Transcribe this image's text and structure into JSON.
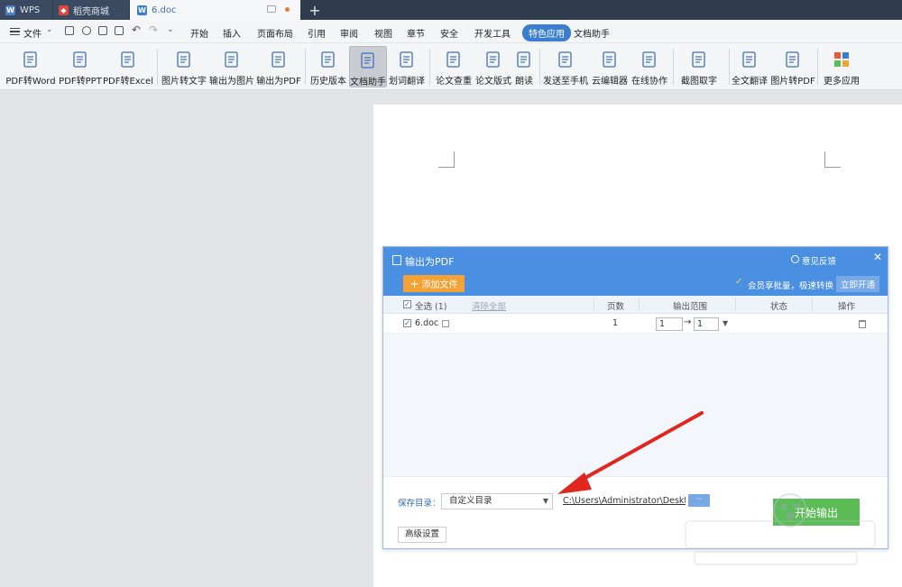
{
  "tabs": {
    "wps": "WPS",
    "shop": "稻壳商城",
    "doc": "6.doc"
  },
  "menu": {
    "file": "文件",
    "items": [
      "开始",
      "插入",
      "页面布局",
      "引用",
      "审阅",
      "视图",
      "章节",
      "安全",
      "开发工具",
      "特色应用",
      "文档助手"
    ],
    "active_index": 9
  },
  "ribbon": [
    {
      "label": "PDF转Word",
      "icon": "pdf-to-word-icon"
    },
    {
      "label": "PDF转PPT",
      "icon": "pdf-to-ppt-icon"
    },
    {
      "label": "PDF转Excel",
      "icon": "pdf-to-excel-icon"
    },
    {
      "label": "图片转文字",
      "icon": "image-to-text-icon"
    },
    {
      "label": "输出为图片",
      "icon": "export-image-icon"
    },
    {
      "label": "输出为PDF",
      "icon": "export-pdf-icon"
    },
    {
      "label": "历史版本",
      "icon": "history-icon"
    },
    {
      "label": "文档助手",
      "icon": "doc-assistant-icon"
    },
    {
      "label": "划词翻译",
      "icon": "translate-icon"
    },
    {
      "label": "论文查重",
      "icon": "plagiarism-check-icon"
    },
    {
      "label": "论文版式",
      "icon": "paper-format-icon"
    },
    {
      "label": "朗读",
      "icon": "read-aloud-icon"
    },
    {
      "label": "发送至手机",
      "icon": "send-to-phone-icon"
    },
    {
      "label": "云编辑器",
      "icon": "cloud-editor-icon"
    },
    {
      "label": "在线协作",
      "icon": "online-collab-icon"
    },
    {
      "label": "截图取字",
      "icon": "screenshot-ocr-icon"
    },
    {
      "label": "全文翻译",
      "icon": "full-translate-icon"
    },
    {
      "label": "图片转PDF",
      "icon": "image-to-pdf-icon"
    },
    {
      "label": "更多应用",
      "icon": "more-apps-icon"
    }
  ],
  "dialog": {
    "title": "输出为PDF",
    "feedback": "意见反馈",
    "add_file": "添加文件",
    "promo": "会员享批量，极速转换",
    "open_vip": "立即开通",
    "columns": {
      "select_all": "全选 (1)",
      "clear_all": "清除全部",
      "pages": "页数",
      "range": "输出范围",
      "status": "状态",
      "action": "操作"
    },
    "rows": [
      {
        "name": "6.doc",
        "pages": "1",
        "range_from": "1",
        "range_to": "1",
        "status": ""
      }
    ],
    "save_label": "保存目录：",
    "save_option": "自定义目录",
    "save_path": "C:\\Users\\Administrator\\Desktop",
    "browse": "···",
    "start": "开始输出",
    "advanced": "高级设置"
  },
  "colors": {
    "accent": "#4a8fe1",
    "start": "#5cbd57",
    "add": "#f3a333",
    "arrow": "#e0261f"
  }
}
